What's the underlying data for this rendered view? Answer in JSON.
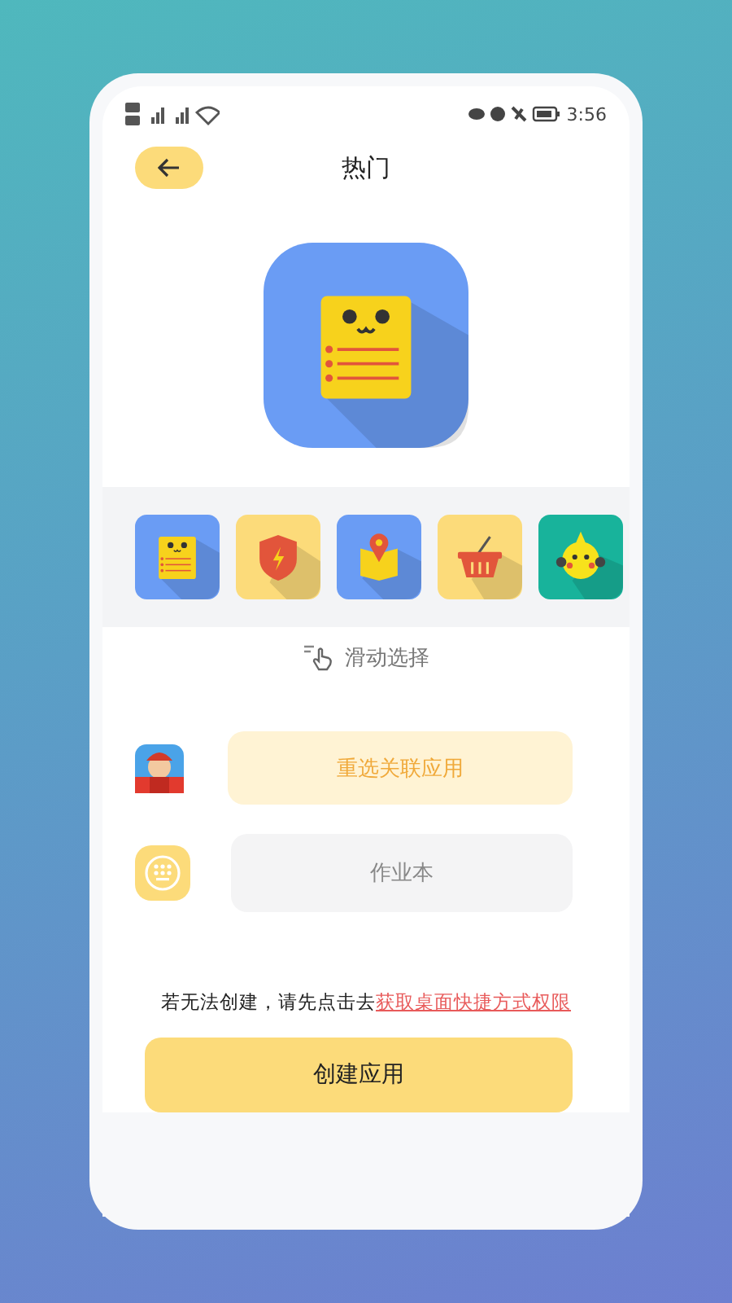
{
  "status_bar": {
    "time": "3:56"
  },
  "header": {
    "title": "热门"
  },
  "preview": {
    "kind": "notepad"
  },
  "icon_options": [
    {
      "kind": "notepad"
    },
    {
      "kind": "shield"
    },
    {
      "kind": "map"
    },
    {
      "kind": "basket"
    },
    {
      "kind": "chick"
    }
  ],
  "swipe_hint": "滑动选择",
  "reselect_button": "重选关联应用",
  "name_field": {
    "placeholder": "作业本"
  },
  "notice": {
    "text": "若无法创建，请先点击去",
    "link": "获取桌面快捷方式权限"
  },
  "create_button": "创建应用"
}
